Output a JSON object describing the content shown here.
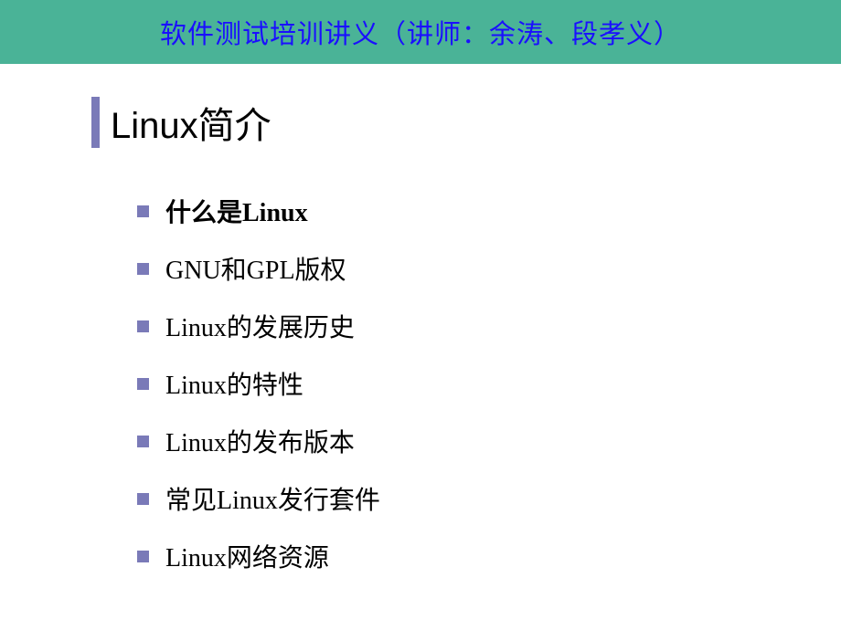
{
  "header": {
    "text": "软件测试培训讲义（讲师：余涛、段孝义）"
  },
  "title": "Linux简介",
  "bullets": [
    {
      "text": "什么是Linux",
      "bold": true
    },
    {
      "text": "GNU和GPL版权",
      "bold": false
    },
    {
      "text": "Linux的发展历史",
      "bold": false
    },
    {
      "text": "Linux的特性",
      "bold": false
    },
    {
      "text": "Linux的发布版本",
      "bold": false
    },
    {
      "text": "常见Linux发行套件",
      "bold": false
    },
    {
      "text": "Linux网络资源",
      "bold": false
    }
  ]
}
